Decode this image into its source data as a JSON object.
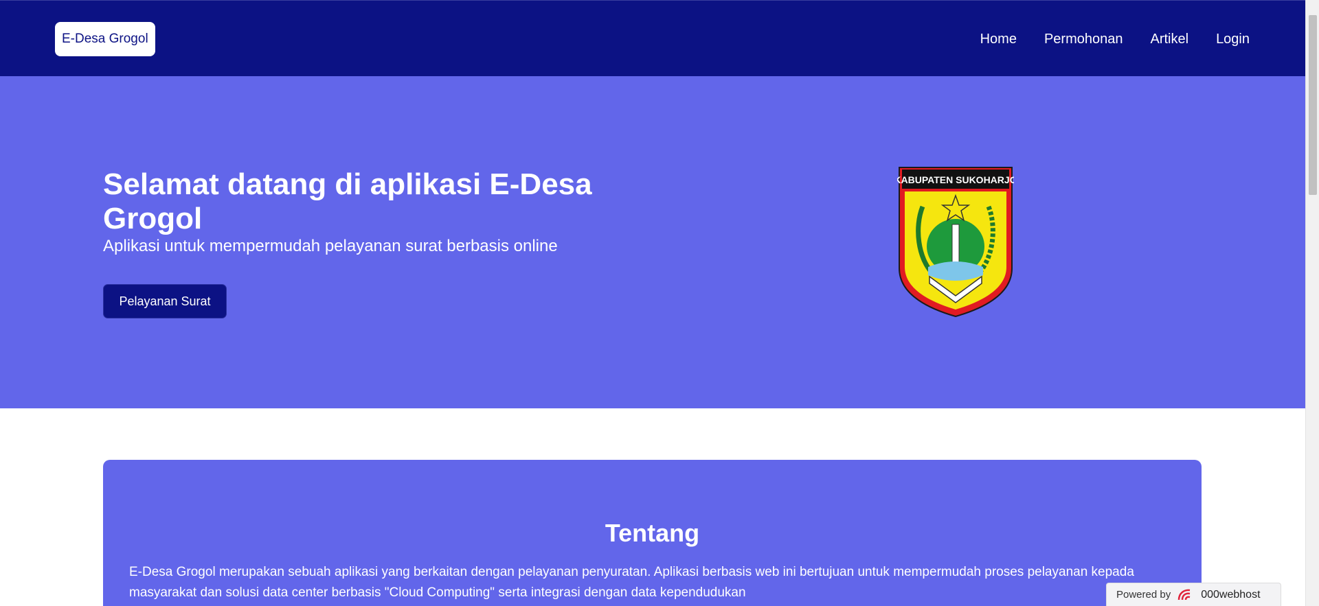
{
  "navbar": {
    "brand": "E-Desa Grogol",
    "links": [
      "Home",
      "Permohonan",
      "Artikel",
      "Login"
    ]
  },
  "hero": {
    "title": "Selamat datang di aplikasi E-Desa Grogol",
    "subtitle": "Aplikasi untuk mempermudah pelayanan surat berbasis online",
    "button": "Pelayanan Surat",
    "logo_text": "KABUPATEN SUKOHARJO"
  },
  "about": {
    "title": "Tentang",
    "text": "E-Desa Grogol merupakan sebuah aplikasi yang berkaitan dengan pelayanan penyuratan. Aplikasi berbasis web ini bertujuan untuk mempermudah proses pelayanan kepada masyarakat dan solusi data center berbasis \"Cloud Computing\" serta integrasi dengan data kependudukan"
  },
  "footer_badge": {
    "label": "Powered by",
    "host": "000webhost"
  },
  "colors": {
    "navbar": "#0c1284",
    "hero": "#6266ea",
    "white": "#ffffff"
  }
}
